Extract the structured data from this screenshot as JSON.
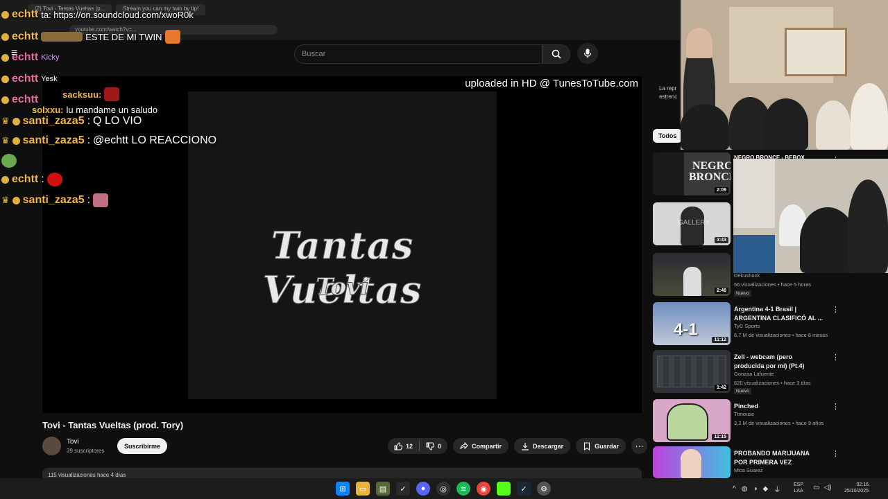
{
  "browser": {
    "tabs": [
      "(2) Tovi - Tantas Vueltas (p...",
      "Stream you can my twin by tip!"
    ],
    "address": "youtube.com/watch?v=..."
  },
  "youtube": {
    "search_placeholder": "Buscar"
  },
  "player": {
    "uploaded_text": "uploaded in HD @ TunesToTube.com",
    "poster_title": "Tantas Vueltas",
    "poster_artist": "Tovi"
  },
  "video": {
    "title": "Tovi - Tantas Vueltas (prod. Tory)",
    "channel": "Tovi",
    "subscribers": "39 suscriptores",
    "subscribe_label": "Suscribirme",
    "likes": "12",
    "dislikes": "0",
    "share_label": "Compartir",
    "download_label": "Descargar",
    "save_label": "Guardar",
    "description_stats": "115 visualizaciones  hace 4 días"
  },
  "sidebar": {
    "note_line1": "La repr",
    "note_line2": "estrenc",
    "chip_all": "Todos",
    "recommendations": [
      {
        "title": "NEGRO BRONCE - BEBOX",
        "duration": "2:09",
        "thumb_text": "NEGRO BRONCE",
        "channel": "",
        "stats": "",
        "badge": ""
      },
      {
        "title": "",
        "duration": "3:43",
        "thumb_text": "GALLERY",
        "channel": "",
        "stats": "",
        "badge": ""
      },
      {
        "title": "",
        "duration": "2:48",
        "thumb_text": "",
        "channel": "Dekushock",
        "stats": "56 visualizaciones • hace 5 horas",
        "badge": "Nuevo"
      },
      {
        "title": "Argentina 4-1 Brasil | ARGENTINA CLASIFICÓ AL ...",
        "duration": "11:12",
        "thumb_text": "4-1",
        "channel": "TyC Sports",
        "stats": "6,7 M de visualizaciones • hace 6 meses",
        "badge": ""
      },
      {
        "title": "Zell - webcam (pero producida por mi) (Pt.4)",
        "duration": "1:42",
        "thumb_text": "",
        "channel": "Gonzaa Lafuente",
        "stats": "620 visualizaciones • hace 3 días",
        "badge": "Nuevo"
      },
      {
        "title": "Pinched",
        "duration": "11:15",
        "thumb_text": "",
        "channel": "Ttmouse",
        "stats": "3,2 M de visualizaciones • hace 9 años",
        "badge": ""
      },
      {
        "title": "PROBANDO MARIJUANA POR PRIMERA VEZ",
        "duration": "",
        "thumb_text": "",
        "channel": "Mica Suarez",
        "stats": "",
        "badge": ""
      }
    ]
  },
  "chat": [
    {
      "user": "echtt",
      "message": "",
      "color": "#f2b84b",
      "badge": "dot"
    },
    {
      "user": "echtt",
      "message": "",
      "color": "#f2b84b",
      "badge": "dot"
    },
    {
      "user": "echtt",
      "message": "",
      "color": "#ee6ba8",
      "badge": "dot"
    },
    {
      "user": "echtt",
      "message": "",
      "color": "#ee6ba8",
      "badge": "dot"
    },
    {
      "user": "echtt",
      "message": "",
      "color": "#ee6ba8",
      "badge": "dot"
    },
    {
      "user": "santi_zaza5",
      "message": "Q LO VIO",
      "color": "#f2b84b",
      "badge": "crown"
    },
    {
      "user": "santi_zaza5",
      "message": "@echtt LO REACCIONO",
      "color": "#f2b84b",
      "badge": "crown"
    },
    {
      "user": "echtt",
      "message": "",
      "color": "#f2b84b",
      "badge": "dot"
    },
    {
      "user": "santi_zaza5",
      "message": "",
      "color": "#f2b84b",
      "badge": "crown"
    }
  ],
  "chat_overlays": {
    "link_line": "ta: https://on.soundcloud.com/xwoR0k",
    "twin_line": "ESTE DE MI TWIN",
    "kicky": "Kicky",
    "yesk": "Yesk",
    "sacksuu": "sacksuu:",
    "solxxu": "solxxu:",
    "solxxu_msg": "lu mandame un saludo"
  },
  "taskbar": {
    "lang_top": "ESP",
    "lang_bottom": "LAA",
    "time": "02:16",
    "date": "25/10/2025"
  },
  "colors": {
    "accent_yellow": "#f2b84b",
    "accent_pink": "#ee6ba8",
    "yt_bg": "#0f0f0f"
  }
}
